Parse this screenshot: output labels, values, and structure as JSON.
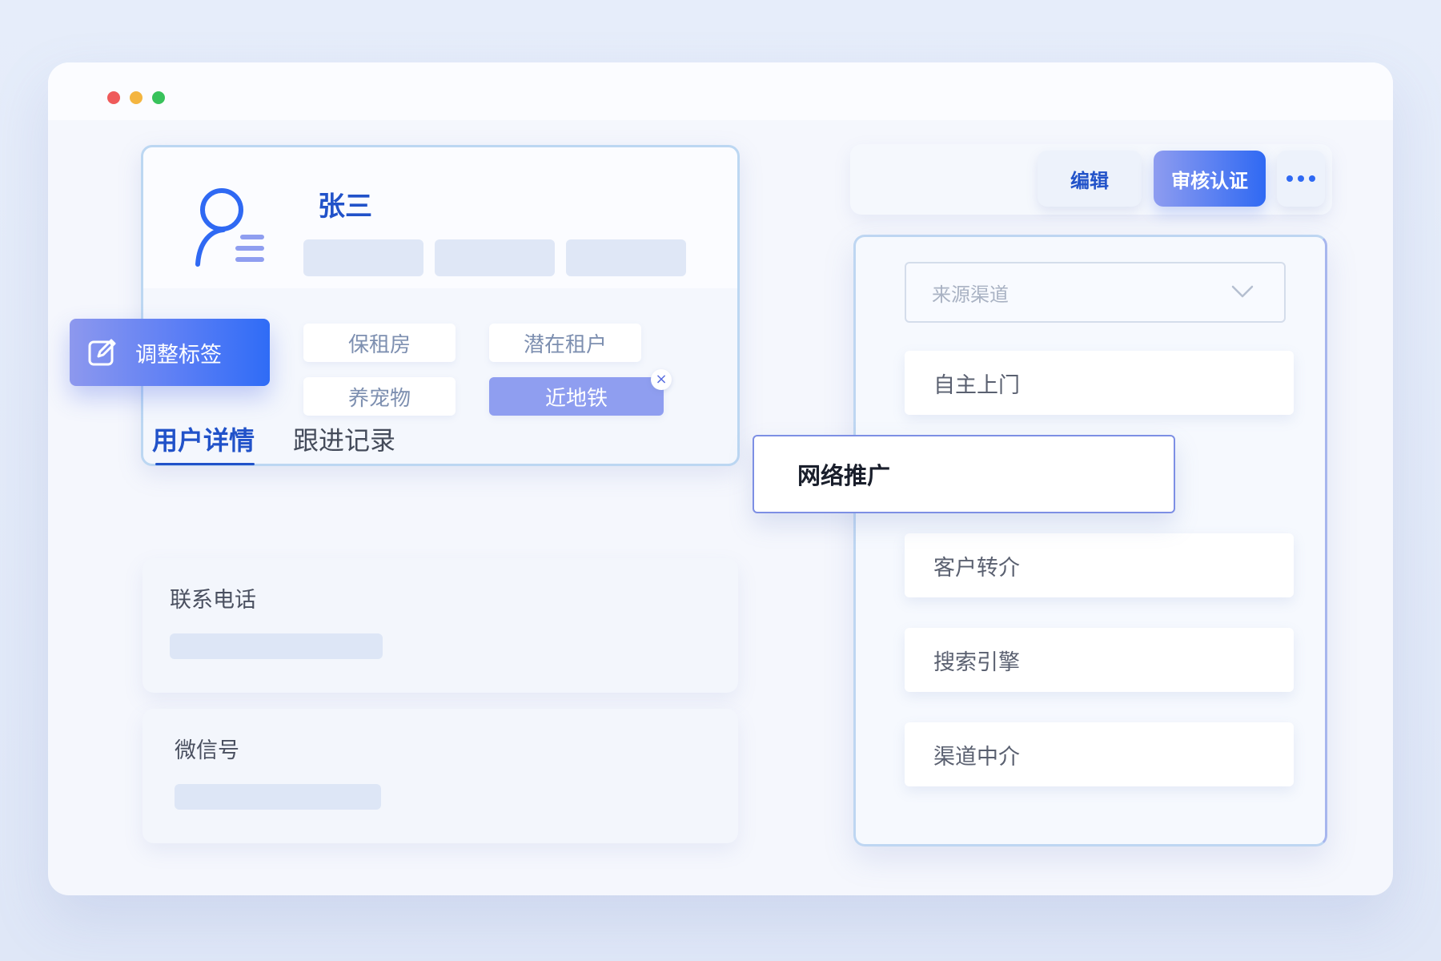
{
  "window": {
    "controls": [
      "close",
      "minimize",
      "maximize"
    ]
  },
  "profile": {
    "name": "张三",
    "tags": [
      {
        "label": "保租房",
        "active": false
      },
      {
        "label": "潜在租户",
        "active": false
      },
      {
        "label": "养宠物",
        "active": false
      },
      {
        "label": "近地铁",
        "active": true
      }
    ],
    "tag_remove_symbol": "×",
    "adjust_tags_label": "调整标签"
  },
  "tabs": [
    {
      "label": "用户详情",
      "active": true
    },
    {
      "label": "跟进记录",
      "active": false
    }
  ],
  "fields": [
    {
      "label": "联系电话"
    },
    {
      "label": "微信号"
    }
  ],
  "toolbar": {
    "edit_label": "编辑",
    "review_label": "审核认证",
    "more_icon": "ellipsis-icon"
  },
  "source_select": {
    "placeholder": "来源渠道",
    "options": [
      "自主上门",
      "网络推广",
      "客户转介",
      "搜索引擎",
      "渠道中介"
    ],
    "selected": "网络推广"
  },
  "colors": {
    "accent": "#2f69f3",
    "brand_text": "#2152c9",
    "active_tag": "#8f9ef0"
  }
}
